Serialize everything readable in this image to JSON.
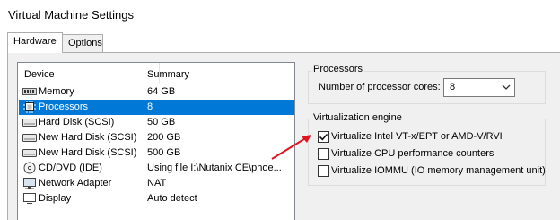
{
  "window": {
    "title": "Virtual Machine Settings"
  },
  "tabs": [
    {
      "label": "Hardware",
      "active": true
    },
    {
      "label": "Options",
      "active": false
    }
  ],
  "device_list": {
    "columns": [
      "Device",
      "Summary"
    ],
    "rows": [
      {
        "device": "Memory",
        "summary": "64 GB",
        "icon": "memory-icon",
        "selected": false
      },
      {
        "device": "Processors",
        "summary": "8",
        "icon": "processor-icon",
        "selected": true
      },
      {
        "device": "Hard Disk (SCSI)",
        "summary": "50 GB",
        "icon": "hard-disk-icon",
        "selected": false
      },
      {
        "device": "New Hard Disk (SCSI)",
        "summary": "200 GB",
        "icon": "hard-disk-icon",
        "selected": false
      },
      {
        "device": "New Hard Disk (SCSI)",
        "summary": "500 GB",
        "icon": "hard-disk-icon",
        "selected": false
      },
      {
        "device": "CD/DVD (IDE)",
        "summary": "Using file I:\\Nutanix CE\\phoe...",
        "icon": "cd-dvd-icon",
        "selected": false
      },
      {
        "device": "Network Adapter",
        "summary": "NAT",
        "icon": "network-adapter-icon",
        "selected": false
      },
      {
        "device": "Display",
        "summary": "Auto detect",
        "icon": "display-icon",
        "selected": false
      }
    ]
  },
  "processors": {
    "group_label": "Processors",
    "cores_label": "Number of processor cores:",
    "cores_value": "8"
  },
  "virtualization": {
    "group_label": "Virtualization engine",
    "options": [
      {
        "label": "Virtualize Intel VT-x/EPT or AMD-V/RVI",
        "checked": true
      },
      {
        "label": "Virtualize CPU performance counters",
        "checked": false
      },
      {
        "label": "Virtualize IOMMU (IO memory management unit)",
        "checked": false
      }
    ]
  },
  "colors": {
    "selection": "#0078d7",
    "annotation_arrow": "#e0141e",
    "panel_bg": "#f0f0f0"
  }
}
